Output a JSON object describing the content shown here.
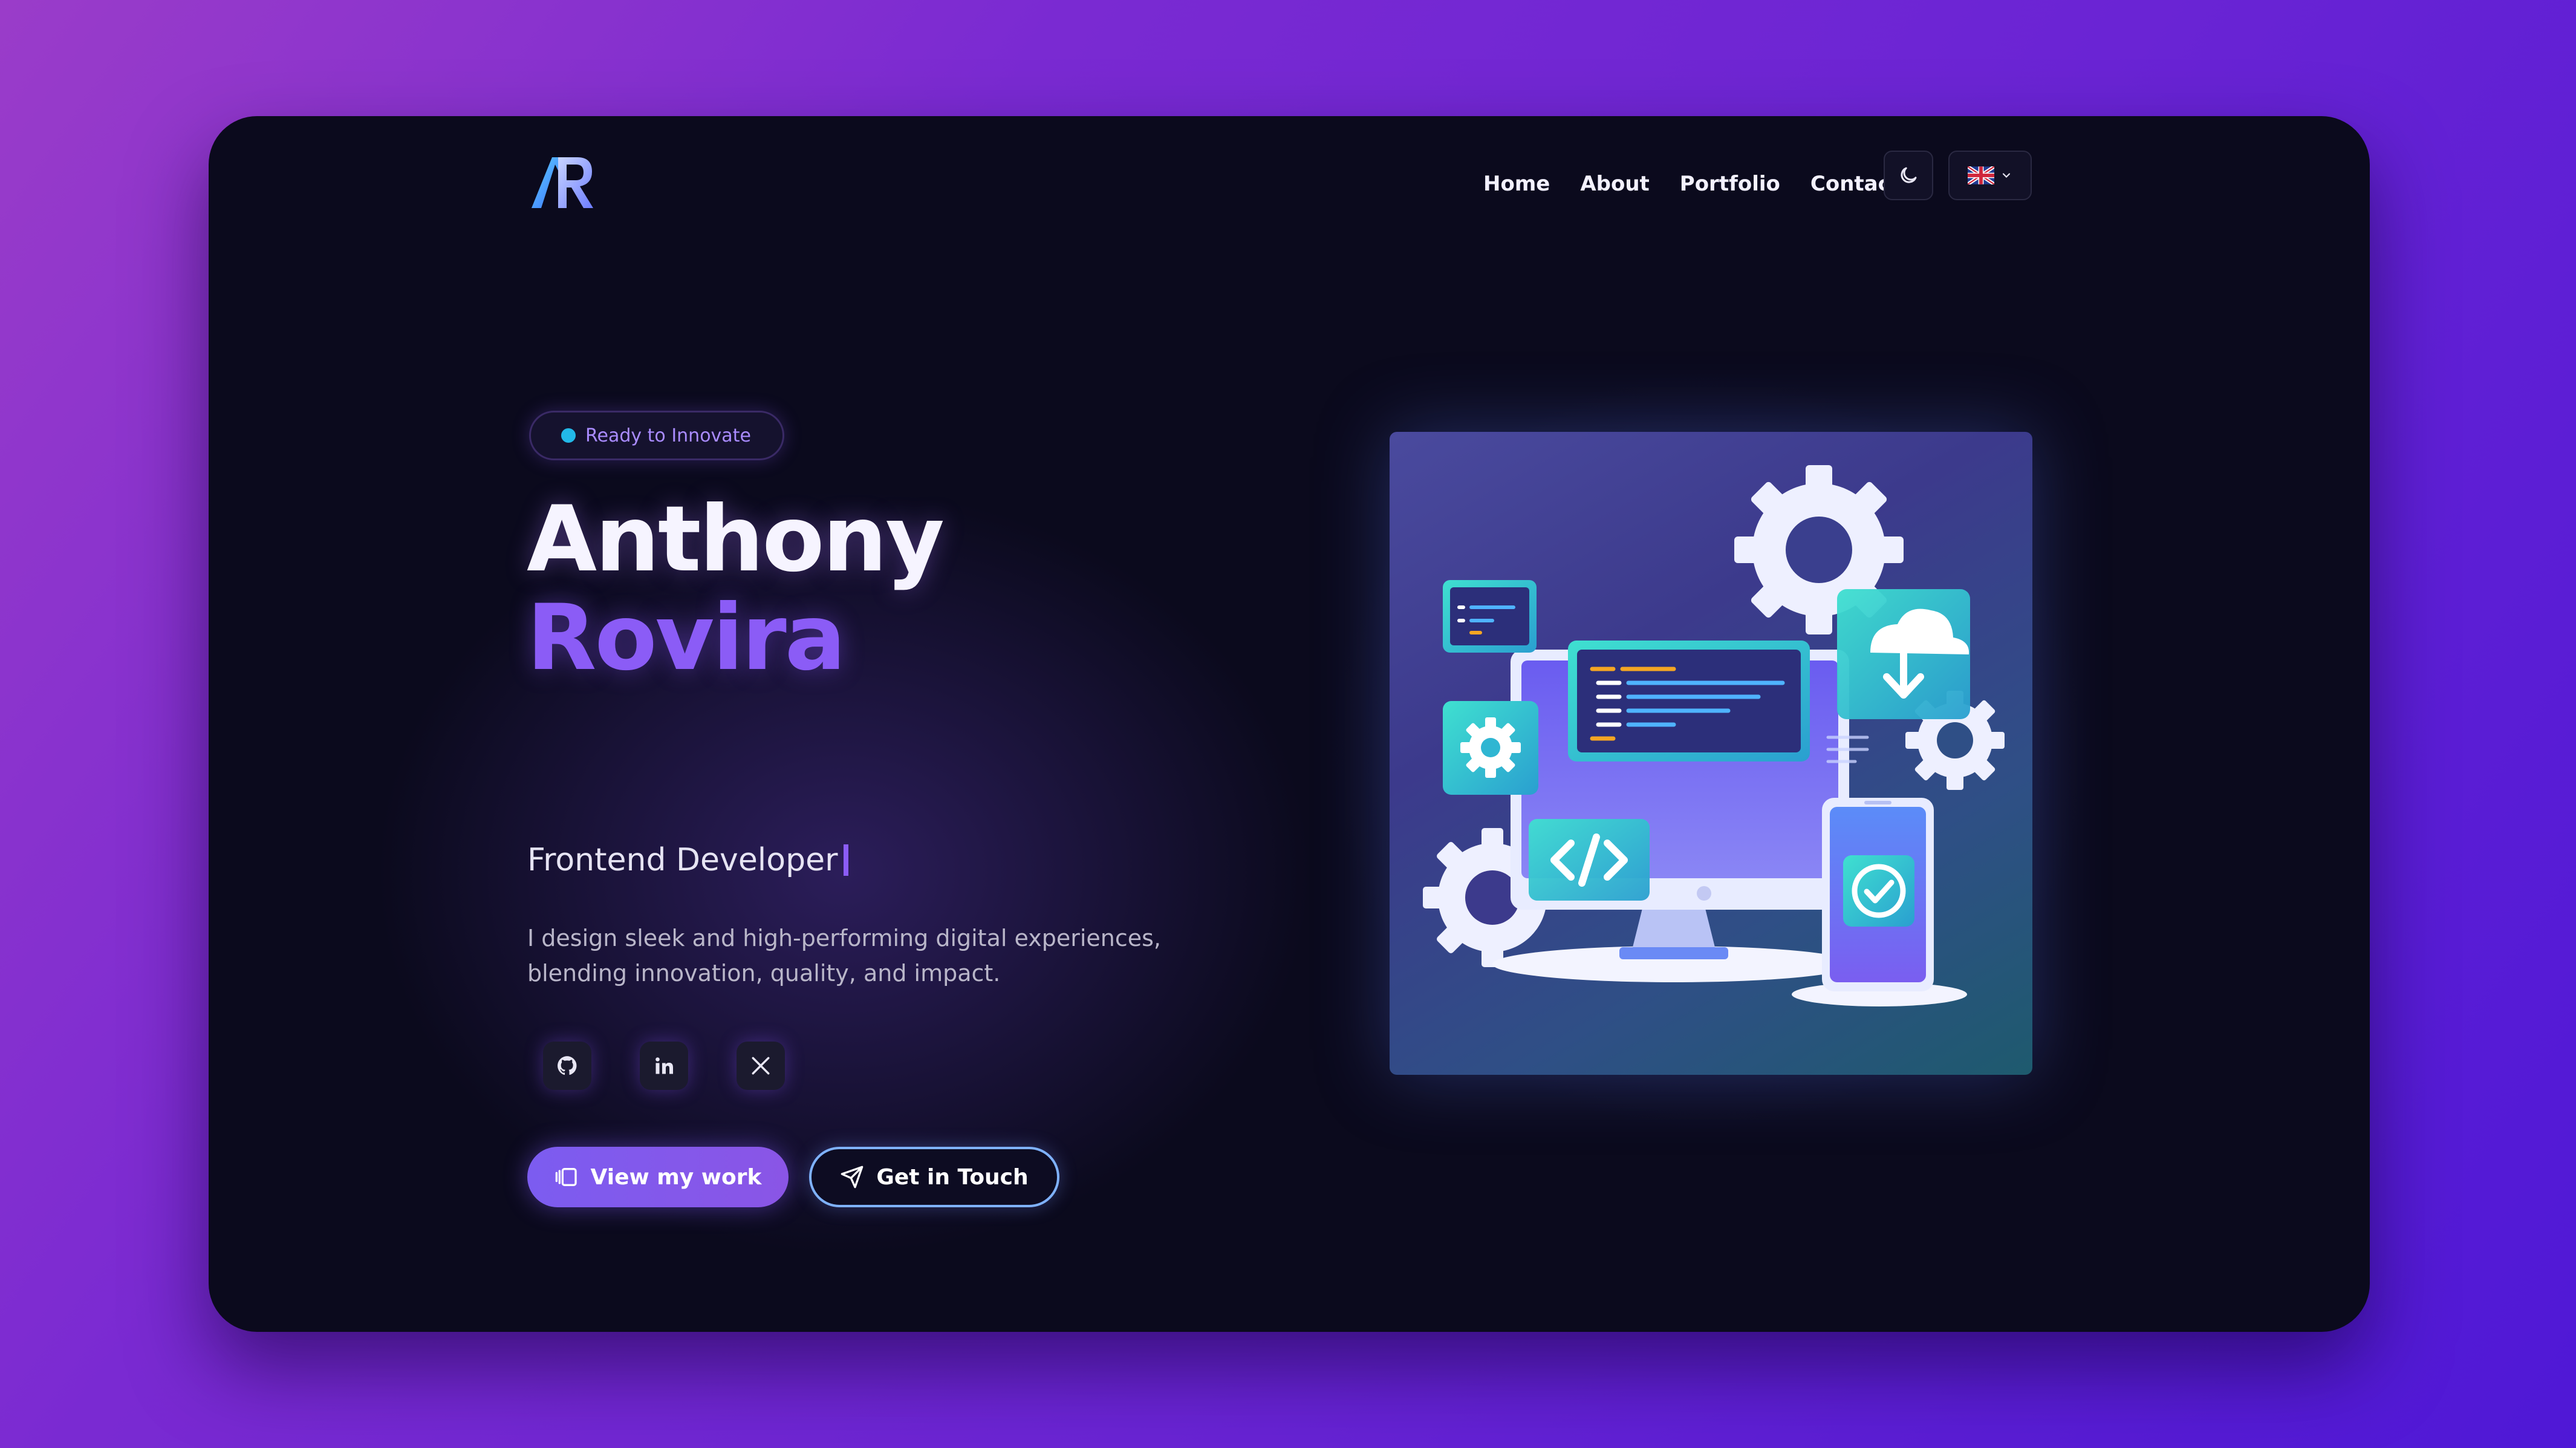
{
  "logo": {
    "text": "AR"
  },
  "nav": {
    "links": [
      "Home",
      "About",
      "Portfolio",
      "Contact"
    ],
    "theme_icon": "moon-icon",
    "language_icon": "uk-flag-icon"
  },
  "hero": {
    "badge": "Ready to Innovate",
    "first_name": "Anthony",
    "last_name": "Rovira",
    "role": "Frontend Developer",
    "description_line1": "I design sleek and high-performing digital experiences,",
    "description_line2": "blending innovation, quality, and impact.",
    "socials": [
      "github-icon",
      "linkedin-icon",
      "x-icon"
    ],
    "primary_button": "View my work",
    "secondary_button": "Get in Touch"
  },
  "colors": {
    "accent": "#8b5cf6",
    "background": "#0b0a1d",
    "badge_dot": "#22b8e8"
  }
}
